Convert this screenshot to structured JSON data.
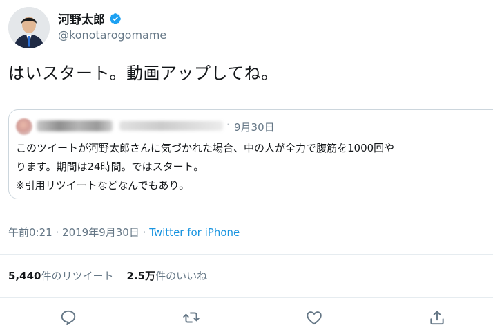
{
  "user": {
    "display_name": "河野太郎",
    "handle": "@konotarogomame",
    "verified_icon": "verified-badge-icon"
  },
  "tweet": {
    "text": "はいスタート。動画アップしてね。"
  },
  "quoted_tweet": {
    "date": "9月30日",
    "lines": [
      "このツイートが河野太郎さんに気づかれた場合、中の人が全力で腹筋を1000回や",
      "ります。期間は24時間。ではスタート。",
      "※引用リツイートなどなんでもあり。"
    ]
  },
  "meta": {
    "time": "午前0:21",
    "separator1": "·",
    "date": "2019年9月30日",
    "separator2": "·",
    "source": "Twitter for iPhone"
  },
  "stats": {
    "retweet_count": "5,440",
    "retweet_label": "件のリツイート",
    "like_count": "2.5万",
    "like_label": "件のいいね"
  },
  "actions": [
    "reply-icon",
    "retweet-icon",
    "like-icon",
    "share-icon"
  ],
  "colors": {
    "text": "#14171a",
    "muted": "#657786",
    "link": "#1b95e0",
    "verified": "#1da1f2",
    "border": "#ccd6dd"
  }
}
